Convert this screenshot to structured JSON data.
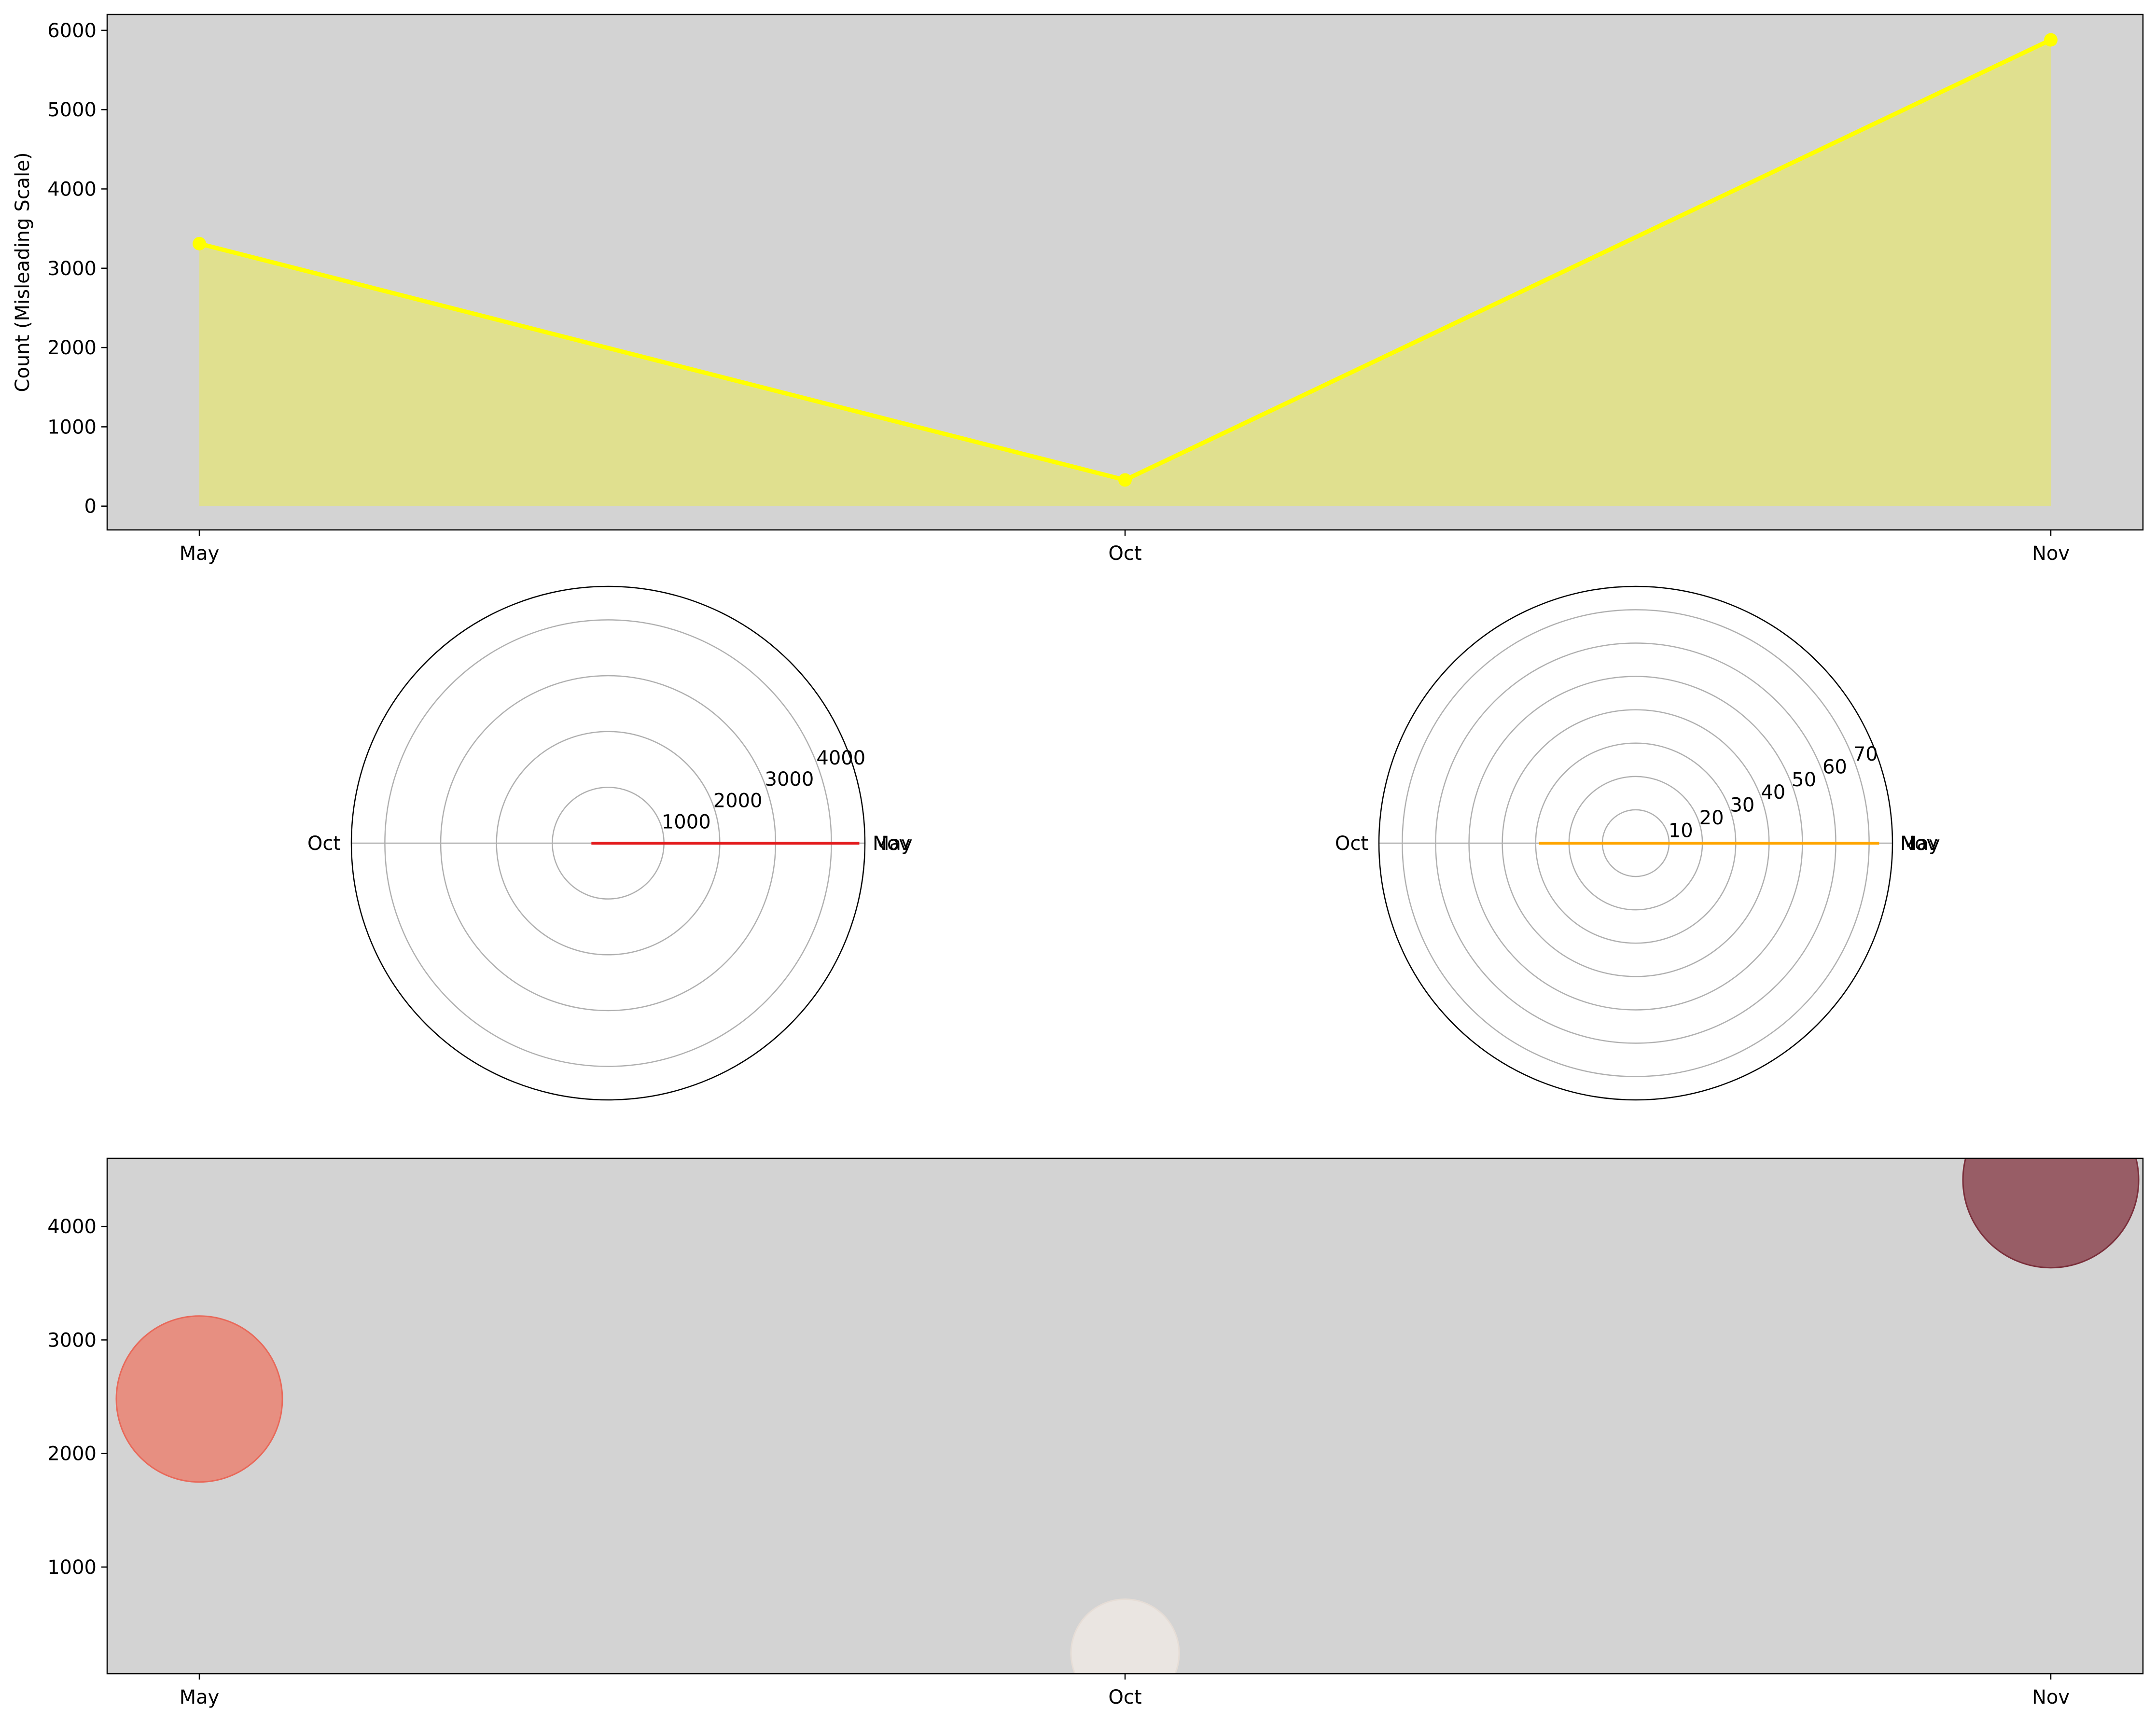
{
  "colors": {
    "axes_background": "#d3d3d3",
    "top_line": "#ffff00",
    "top_fill": "#e0e08f",
    "polar_left_line": "#e31a1c",
    "polar_right_line": "#ffa500",
    "bubble_may": "#e8897a",
    "bubble_oct": "#ebe6e2",
    "bubble_nov": "#93525c",
    "polar_grid": "#b0b0b0"
  },
  "chart_data": [
    {
      "type": "area",
      "title": "",
      "categories": [
        "May",
        "Oct",
        "Nov"
      ],
      "series": [
        {
          "values": [
            3310,
            330,
            5880
          ]
        }
      ],
      "xlabel": "",
      "ylabel": "Count (Misleading Scale)",
      "ylim": [
        -300,
        6200
      ],
      "yticks": [
        0,
        1000,
        2000,
        3000,
        4000,
        5000,
        6000
      ],
      "markers": true,
      "grid": false
    },
    {
      "type": "line",
      "projection": "polar",
      "theta_labels": [
        "May",
        "Oct",
        "Nov"
      ],
      "theta_labels_note_overlap": "May and Nov share angle 0",
      "rticks": [
        1000,
        2000,
        3000,
        4000
      ],
      "rmax": 4600,
      "series": [
        {
          "values": [
            4500,
            300,
            4500
          ]
        }
      ],
      "grid": true
    },
    {
      "type": "line",
      "projection": "polar",
      "theta_labels": [
        "May",
        "Oct",
        "Nov"
      ],
      "rticks": [
        10,
        20,
        30,
        40,
        50,
        60,
        70
      ],
      "rmax": 77,
      "series": [
        {
          "values": [
            73,
            29,
            73
          ]
        }
      ],
      "grid": true
    },
    {
      "type": "scatter",
      "title": "",
      "categories": [
        "May",
        "Oct",
        "Nov"
      ],
      "points": [
        {
          "x": "May",
          "y": 2480,
          "size_rank": 2
        },
        {
          "x": "Oct",
          "y": 240,
          "size_rank": 1
        },
        {
          "x": "Nov",
          "y": 4410,
          "size_rank": 2
        }
      ],
      "xlabel": "",
      "ylabel": "",
      "ylim": [
        60,
        4600
      ],
      "yticks": [
        1000,
        2000,
        3000,
        4000
      ],
      "grid": false
    }
  ]
}
